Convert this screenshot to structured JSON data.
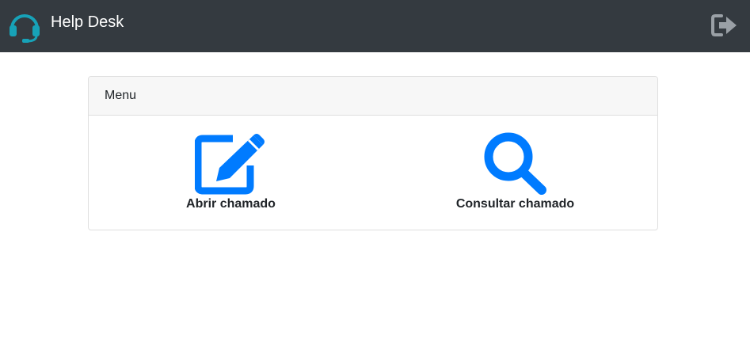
{
  "navbar": {
    "logo_icon": "headset-icon",
    "title": "Help Desk",
    "logout_icon": "sign-out-icon"
  },
  "menu": {
    "header": "Menu",
    "items": [
      {
        "label": "Abrir chamado",
        "icon": "edit-icon"
      },
      {
        "label": "Consultar chamado",
        "icon": "search-icon"
      }
    ]
  },
  "colors": {
    "navbar": "#343a40",
    "logo": "#17a2b8",
    "accent": "#007bff",
    "logout_icon": "#9aa0a6"
  }
}
